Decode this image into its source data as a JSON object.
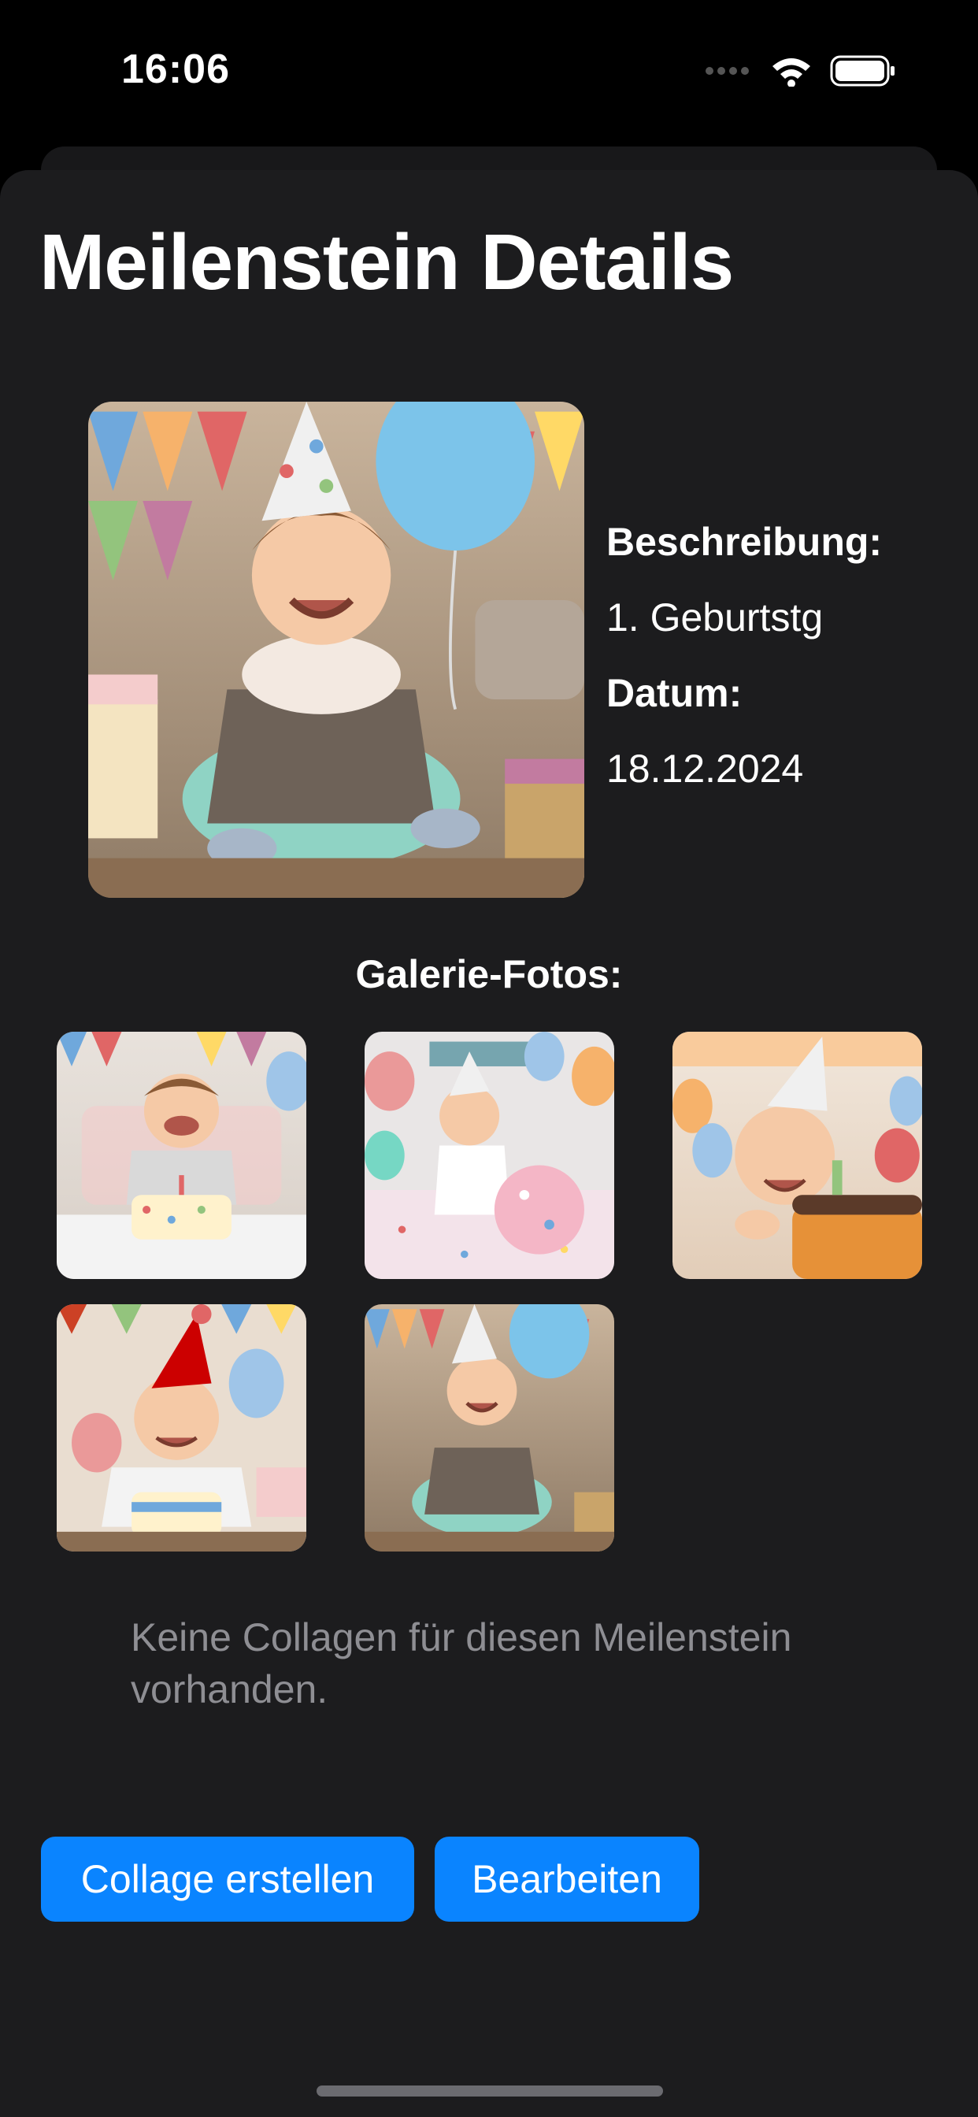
{
  "status_bar": {
    "time": "16:06",
    "icons": [
      "cellular-dots-icon",
      "wifi-icon",
      "battery-icon"
    ]
  },
  "page": {
    "title": "Meilenstein Details"
  },
  "details": {
    "description_label": "Beschreibung:",
    "description_value": "1. Geburtstg",
    "date_label": "Datum:",
    "date_value": "18.12.2024"
  },
  "gallery": {
    "title": "Galerie-Fotos:",
    "photo_count": 5
  },
  "collages": {
    "empty_message": "Keine Collagen für diesen Meilenstein vorhanden."
  },
  "actions": {
    "create_collage_label": "Collage erstellen",
    "edit_label": "Bearbeiten"
  },
  "colors": {
    "background": "#000000",
    "sheet": "#1c1c1e",
    "accent": "#0a84ff",
    "secondary_text": "#8e8e93"
  }
}
